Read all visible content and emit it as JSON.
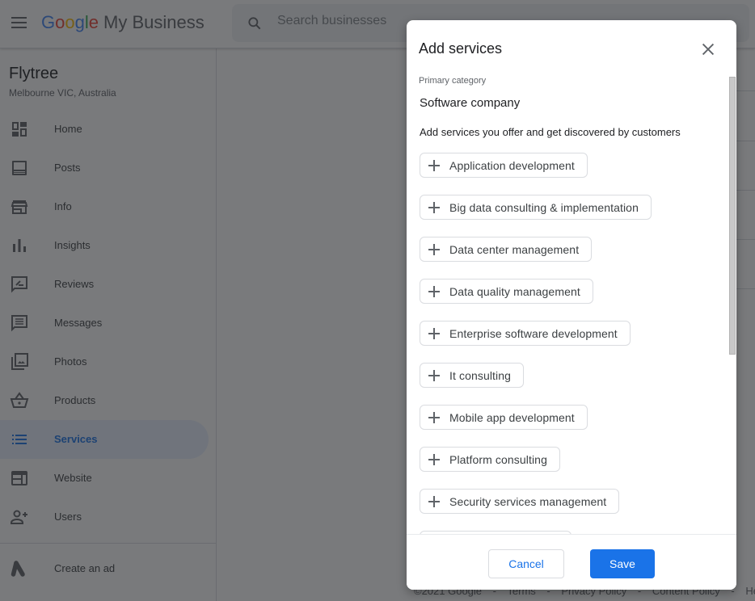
{
  "header": {
    "logo_letters": [
      "G",
      "o",
      "o",
      "g",
      "l",
      "e"
    ],
    "product_name": "My Business",
    "search_placeholder": "Search businesses",
    "search_value": ""
  },
  "business": {
    "name": "Flytree",
    "location": "Melbourne VIC, Australia"
  },
  "sidebar": {
    "items": [
      {
        "label": "Home",
        "icon": "dashboard-icon"
      },
      {
        "label": "Posts",
        "icon": "posts-icon"
      },
      {
        "label": "Info",
        "icon": "storefront-icon"
      },
      {
        "label": "Insights",
        "icon": "bar-chart-icon"
      },
      {
        "label": "Reviews",
        "icon": "rate-review-icon"
      },
      {
        "label": "Messages",
        "icon": "message-icon"
      },
      {
        "label": "Photos",
        "icon": "photo-library-icon"
      },
      {
        "label": "Products",
        "icon": "basket-icon"
      },
      {
        "label": "Services",
        "icon": "list-icon",
        "active": true
      },
      {
        "label": "Website",
        "icon": "web-icon"
      },
      {
        "label": "Users",
        "icon": "person-add-icon"
      }
    ],
    "create_ad": {
      "label": "Create an ad",
      "icon": "google-ads-icon"
    }
  },
  "footer": {
    "links": [
      "©2021 Google",
      "-",
      "Terms",
      "-",
      "Privacy Policy",
      "-",
      "Content Policy",
      "-",
      "Hel"
    ]
  },
  "dialog": {
    "title": "Add services",
    "primary_category_label": "Primary category",
    "primary_category_value": "Software company",
    "call_to_action": "Add services you offer and get discovered by customers",
    "services": [
      "Application development",
      "Big data consulting & implementation",
      "Data center management",
      "Data quality management",
      "Enterprise software development",
      "It consulting",
      "Mobile app development",
      "Platform consulting",
      "Security services management",
      ""
    ],
    "cancel_label": "Cancel",
    "save_label": "Save",
    "colors": {
      "primary": "#1a73e8",
      "chip_border": "#dadce0"
    }
  }
}
